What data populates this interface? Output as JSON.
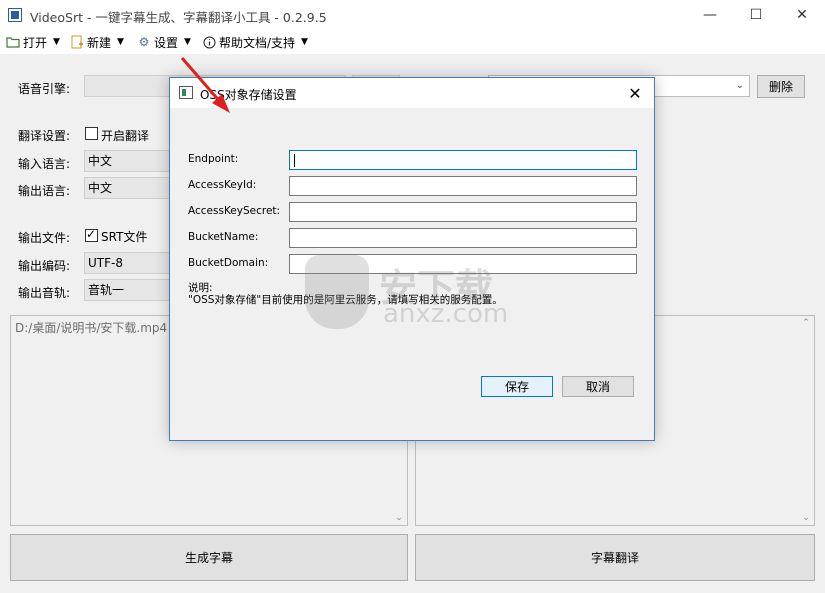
{
  "window": {
    "title": "VideoSrt - 一键字幕生成、字幕翻译小工具 - 0.2.9.5",
    "minimize": "—",
    "maximize": "☐",
    "close": "✕"
  },
  "menu": {
    "items": [
      {
        "label": "打开",
        "icon": "folder-icon"
      },
      {
        "label": "新建",
        "icon": "new-file-icon"
      },
      {
        "label": "设置",
        "icon": "gear-icon"
      },
      {
        "label": "帮助文档/支持",
        "icon": "info-icon"
      }
    ]
  },
  "form": {
    "engine_label": "语音引擎:",
    "delete_button": "删除",
    "translate_settings_label": "翻译设置:",
    "enable_translate_label": "开启翻译",
    "input_lang_label": "输入语言:",
    "input_lang_value": "中文",
    "output_lang_label": "输出语言:",
    "output_lang_value": "中文",
    "output_file_label": "输出文件:",
    "srt_label": "SRT文件",
    "output_encoding_label": "输出编码:",
    "output_encoding_value": "UTF-8",
    "output_track_label": "输出音轨:",
    "output_track_value": "音轨一"
  },
  "panels": {
    "left_text": "D:/桌面/说明书/安下载.mp4",
    "right_text": ""
  },
  "buttons": {
    "generate": "生成字幕",
    "translate": "字幕翻译"
  },
  "watermark": {
    "text": "安下载",
    "sub": "anxz.com"
  },
  "dialog": {
    "title": "OSS对象存储设置",
    "fields": [
      {
        "label": "Endpoint:",
        "value": ""
      },
      {
        "label": "AccessKeyId:",
        "value": ""
      },
      {
        "label": "AccessKeySecret:",
        "value": ""
      },
      {
        "label": "BucketName:",
        "value": ""
      },
      {
        "label": "BucketDomain:",
        "value": ""
      }
    ],
    "note_title": "说明:",
    "note_text": "\"OSS对象存储\"目前使用的是阿里云服务，请填写相关的服务配置。",
    "save": "保存",
    "cancel": "取消"
  },
  "colors": {
    "accent": "#0078d7",
    "arrow": "#e0201e"
  }
}
